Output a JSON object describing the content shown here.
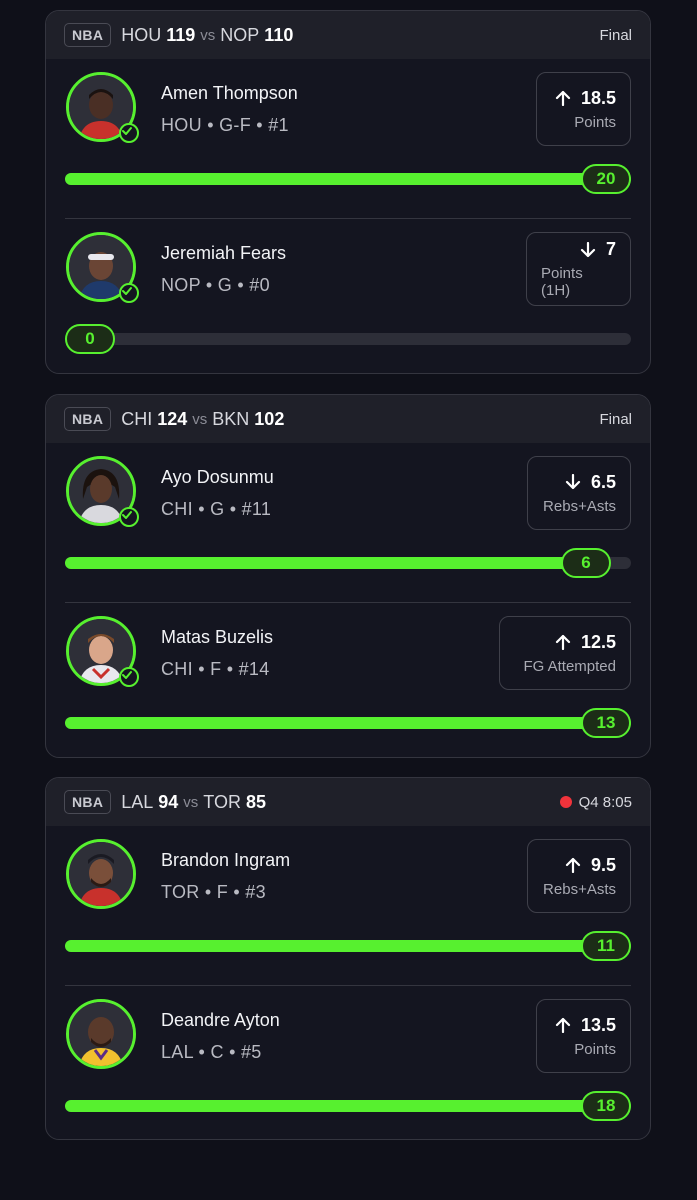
{
  "games": [
    {
      "league": "NBA",
      "team1": "HOU",
      "score1": "119",
      "vs": "vs",
      "team2": "NOP",
      "score2": "110",
      "status": "Final",
      "live": false,
      "players": [
        {
          "name": "Amen Thompson",
          "meta": "HOU • G-F • #1",
          "direction": "up",
          "line": "18.5",
          "stat": "Points",
          "current": "20",
          "progress": 1.0,
          "checked": true
        },
        {
          "name": "Jeremiah Fears",
          "meta": "NOP • G • #0",
          "direction": "down",
          "line": "7",
          "stat": "Points (1H)",
          "current": "0",
          "progress": 0.0,
          "checked": true
        }
      ]
    },
    {
      "league": "NBA",
      "team1": "CHI",
      "score1": "124",
      "vs": "vs",
      "team2": "BKN",
      "score2": "102",
      "status": "Final",
      "live": false,
      "players": [
        {
          "name": "Ayo Dosunmu",
          "meta": "CHI • G • #11",
          "direction": "down",
          "line": "6.5",
          "stat": "Rebs+Asts",
          "current": "6",
          "progress": 0.92,
          "checked": true
        },
        {
          "name": "Matas Buzelis",
          "meta": "CHI • F • #14",
          "direction": "up",
          "line": "12.5",
          "stat": "FG Attempted",
          "current": "13",
          "progress": 1.0,
          "checked": true
        }
      ]
    },
    {
      "league": "NBA",
      "team1": "LAL",
      "score1": "94",
      "vs": "vs",
      "team2": "TOR",
      "score2": "85",
      "status": "Q4 8:05",
      "live": true,
      "players": [
        {
          "name": "Brandon Ingram",
          "meta": "TOR • F • #3",
          "direction": "up",
          "line": "9.5",
          "stat": "Rebs+Asts",
          "current": "11",
          "progress": 1.0,
          "checked": false
        },
        {
          "name": "Deandre Ayton",
          "meta": "LAL • C • #5",
          "direction": "up",
          "line": "13.5",
          "stat": "Points",
          "current": "18",
          "progress": 1.0,
          "checked": false
        }
      ]
    }
  ],
  "colors": {
    "accent": "#57f02f",
    "live": "#f0333b",
    "card": "#141520",
    "header": "#1f2029"
  },
  "icons": {
    "up": "arrow-up-icon",
    "down": "arrow-down-icon",
    "check": "check-icon",
    "live": "live-dot-icon"
  }
}
